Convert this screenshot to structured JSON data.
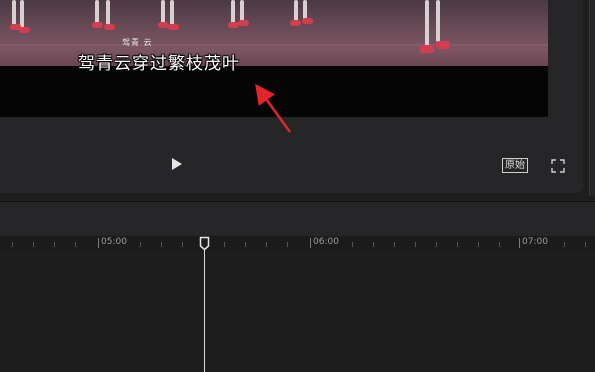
{
  "video": {
    "annotation_small": "驾青  云",
    "subtitle": "驾青云穿过繁枝茂叶"
  },
  "controls": {
    "play_icon": "play-icon",
    "original_label": "原始",
    "fullscreen_icon": "fullscreen-icon"
  },
  "timeline": {
    "ticks": [
      "05:00",
      "06:00",
      "07:00"
    ],
    "playhead_icon": "playhead-icon"
  },
  "colors": {
    "arrow": "#e3242b",
    "shoe": "#d23e4f",
    "background": "#1e1e1f",
    "panel": "#262628"
  }
}
